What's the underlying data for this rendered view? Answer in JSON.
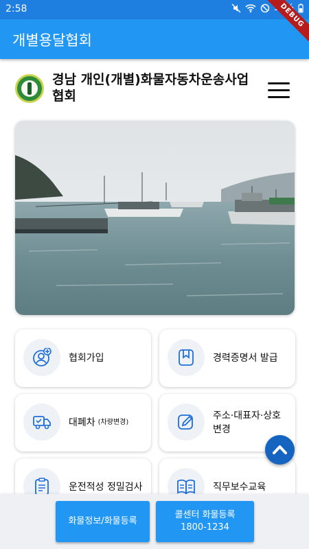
{
  "status_bar": {
    "time": "2:58",
    "battery": "57%"
  },
  "debug_banner": "DEBUG",
  "app_bar": {
    "title": "개별용달협회"
  },
  "header": {
    "title": "경남 개인(개별)화물자동차운송사업협회"
  },
  "colors": {
    "primary": "#2196f3",
    "status": "#1f7fe0",
    "fab": "#1565c0",
    "icon_blue": "#1e6fd9",
    "icon_bg": "#eef1f6"
  },
  "menu": [
    {
      "label": "협회가입",
      "icon": "add-member-icon"
    },
    {
      "label": "경력증명서 발급",
      "icon": "bookmark-icon"
    },
    {
      "label": "대폐차",
      "sub": "(차량변경)",
      "icon": "truck-icon"
    },
    {
      "label": "주소·대표자·상호 변경",
      "icon": "edit-icon"
    },
    {
      "label": "운전적성 정밀검사",
      "icon": "clipboard-icon"
    },
    {
      "label": "직무보수교육",
      "icon": "book-icon"
    }
  ],
  "bottom": {
    "btn1": "화물정보/화물등록",
    "btn2_line1": "콜센터 화물등록",
    "btn2_line2": "1800-1234"
  }
}
